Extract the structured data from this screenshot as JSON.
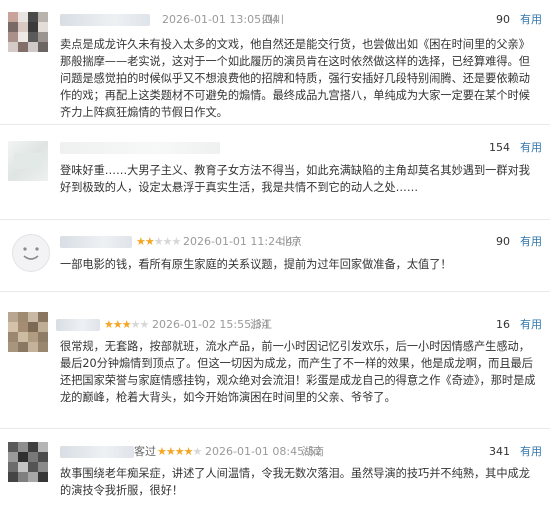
{
  "reviews": [
    {
      "username_suffix": "",
      "rating": 0,
      "date": "2026-01-01 13:05:04",
      "location": "四川",
      "votes": "90",
      "useful_label": "有用",
      "content": "卖点是成龙许久未有投入太多的文戏，他自然还是能交行货，也尝做出如《困在时间里的父亲》那般揣摩——老实说，这对于一个如此履历的演员肯在这时依然做这样的选择，已经算难得。但问题是感觉拍的时候似乎又不想浪费他的招牌和特质，强行安插好几段特别闹腾、还是要依赖动作的戏；再配上这类题材不可避免的煽情。最终成品九宫搭八，单纯成为大家一定要在某个时候齐力上阵疯狂煽情的节假日作文。"
    },
    {
      "username_suffix": "",
      "rating": 0,
      "date": "",
      "location": "",
      "votes": "154",
      "useful_label": "有用",
      "content": "登味好重……大男子主义、教育子女方法不得当，如此充满缺陷的主角却莫名其妙遇到一群对我好到极致的人，设定太悬浮于真实生活，我是共情不到它的动人之处……"
    },
    {
      "username_suffix": "",
      "rating": 2,
      "date": "2026-01-01 11:24:47",
      "location": "北京",
      "votes": "90",
      "useful_label": "有用",
      "content": "一部电影的钱，看所有原生家庭的关系议题，提前为过年回家做准备，太值了！"
    },
    {
      "username_suffix": "",
      "rating": 3,
      "date": "2026-01-02 15:55:34",
      "location": "浙江",
      "votes": "16",
      "useful_label": "有用",
      "content": "很常规，无套路，按部就班，流水产品，前一小时因记忆引发欢乐，后一小时因情感产生感动，最后20分钟煽情到顶点了。但这一切因为成龙，而产生了不一样的效果，他是成龙啊，而且最后还把国家荣誉与家庭情感挂钩，观众绝对会流泪！彩蛋是成龙自己的得意之作《奇迹》，那时是成龙的巅峰，枪着大背头，如今开始饰演困在时间里的父亲、爷爷了。"
    },
    {
      "username_suffix": "客过",
      "rating": 4,
      "date": "2026-01-01 08:45:52",
      "location": "湖南",
      "votes": "341",
      "useful_label": "有用",
      "content": "故事围绕老年痴呆症，讲述了人间温情，令我无数次落泪。虽然导演的技巧并不纯熟，其中成龙的演技令我折服，很好！"
    }
  ]
}
